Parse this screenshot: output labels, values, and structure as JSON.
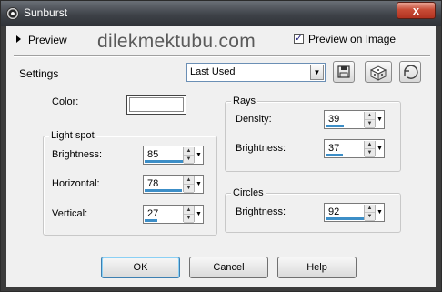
{
  "window": {
    "title": "Sunburst",
    "close_glyph": "x"
  },
  "preview": {
    "label": "Preview",
    "watermark": "dilekmektubu.com",
    "preview_on_image_label": "Preview on Image",
    "preview_on_image_checked": true
  },
  "settings": {
    "label": "Settings",
    "value": "Last Used"
  },
  "color": {
    "label": "Color:",
    "value": "#ffffff"
  },
  "light_spot": {
    "title": "Light spot",
    "brightness": {
      "label": "Brightness:",
      "value": "85",
      "level": 0.85
    },
    "horizontal": {
      "label": "Horizontal:",
      "value": "78",
      "level": 0.78
    },
    "vertical": {
      "label": "Vertical:",
      "value": "27",
      "level": 0.27
    }
  },
  "rays": {
    "title": "Rays",
    "density": {
      "label": "Density:",
      "value": "39",
      "level": 0.39
    },
    "brightness": {
      "label": "Brightness:",
      "value": "37",
      "level": 0.37
    }
  },
  "circles": {
    "title": "Circles",
    "brightness": {
      "label": "Brightness:",
      "value": "92",
      "level": 0.92
    }
  },
  "buttons": {
    "ok": "OK",
    "cancel": "Cancel",
    "help": "Help"
  },
  "colors": {
    "spin_bar": "#3c8ec7",
    "close": "#c84c36"
  }
}
